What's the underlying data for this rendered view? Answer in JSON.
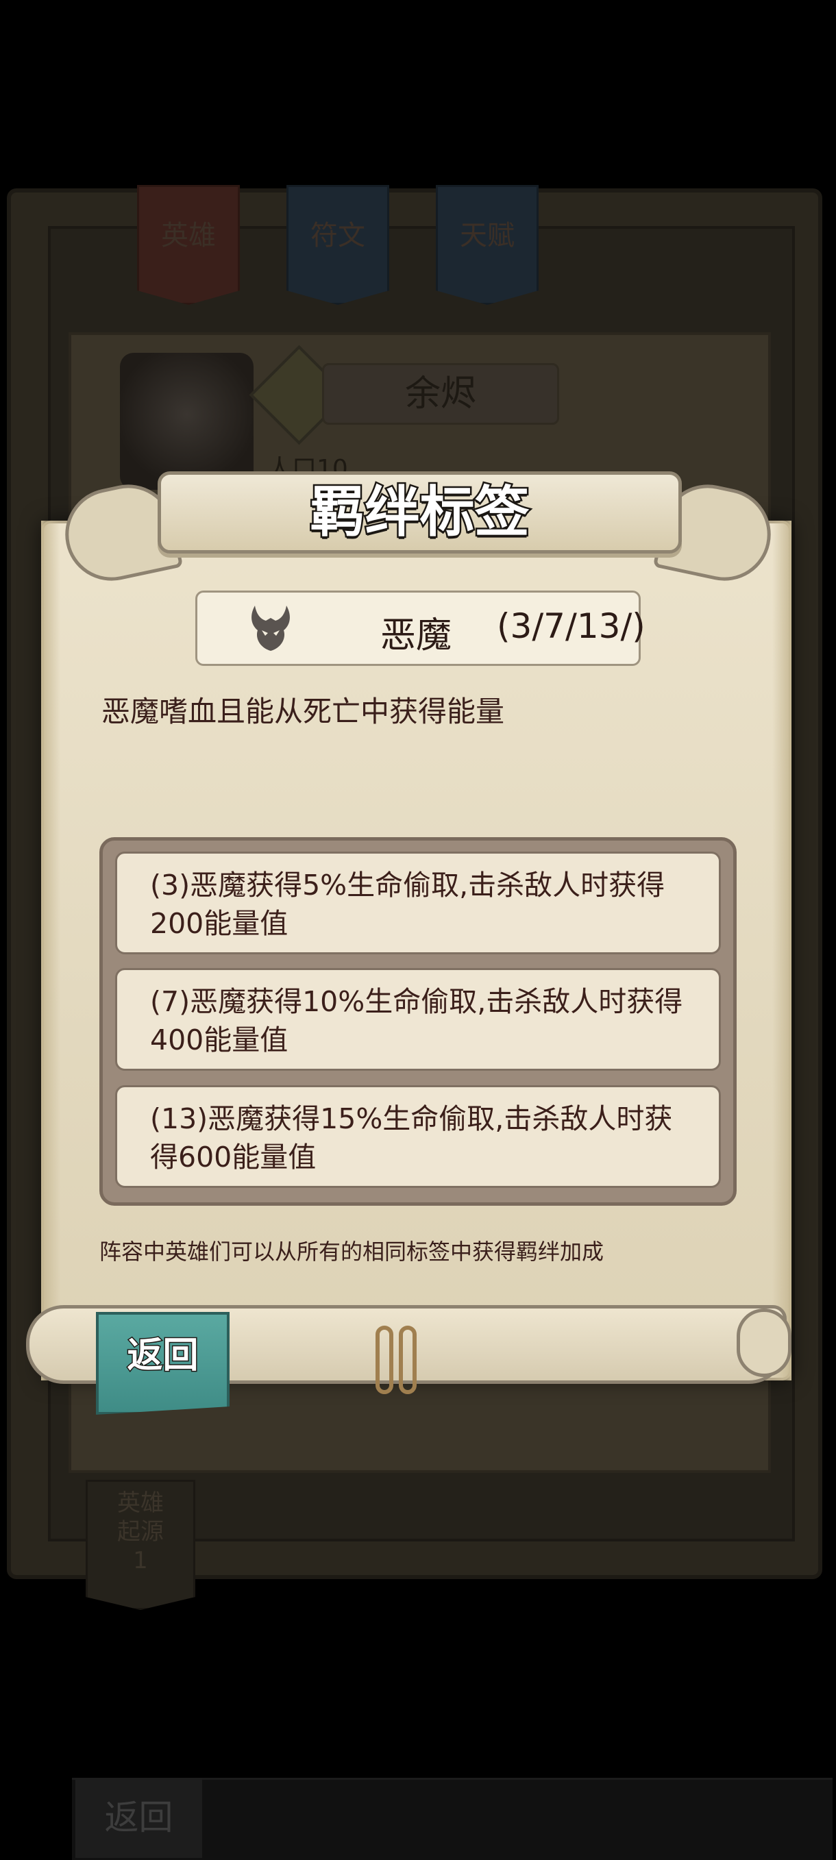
{
  "background": {
    "tabs": [
      "英雄",
      "符文",
      "天赋"
    ],
    "hero_name": "余烬",
    "population": "人口10",
    "bottom_tab": [
      "英雄",
      "起源",
      "1"
    ],
    "return_label": "返回"
  },
  "dialog": {
    "title": "羁绊标签",
    "tag": {
      "icon": "demon-horns-icon",
      "name": "恶魔",
      "count": "(3/7/13/)"
    },
    "description": "恶魔嗜血且能从死亡中获得能量",
    "bonuses": [
      {
        "line1": "(3)恶魔获得5%生命偷取,击杀敌人时获得",
        "line2": "200能量值"
      },
      {
        "line1": "(7)恶魔获得10%生命偷取,击杀敌人时获得",
        "line2": "400能量值"
      },
      {
        "line1": "(13)恶魔获得15%生命偷取,击杀敌人时获",
        "line2": "得600能量值"
      }
    ],
    "footer_note": "阵容中英雄们可以从所有的相同标签中获得羁绊加成",
    "return_label": "返回"
  },
  "colors": {
    "parchment": "#e3d9bf",
    "return_button": "#4f9e97",
    "text_dark_red": "#3a1f1b",
    "bonus_panel": "#9b8a7b"
  }
}
